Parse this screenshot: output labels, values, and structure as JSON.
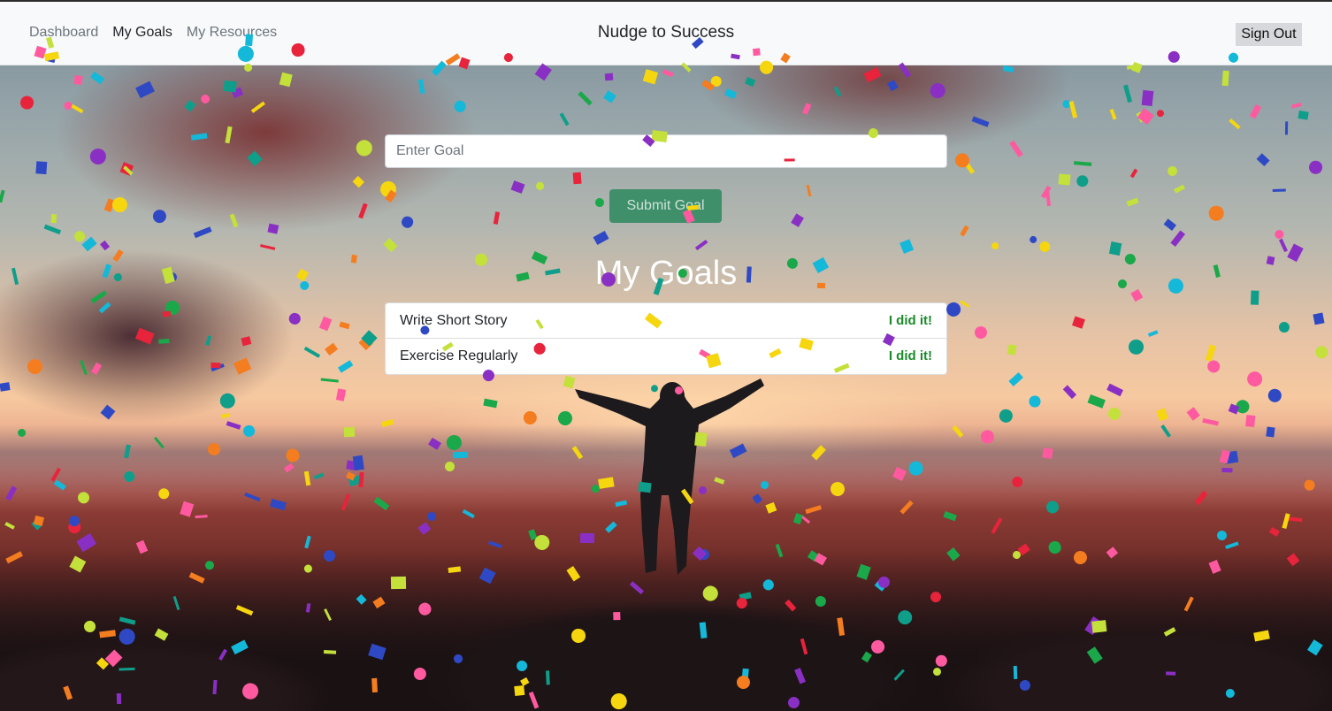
{
  "nav": {
    "links": [
      "Dashboard",
      "My Goals",
      "My Resources"
    ],
    "active": "My Goals",
    "brand": "Nudge to Success",
    "sign_out_label": "Sign Out"
  },
  "goal_form": {
    "placeholder": "Enter Goal",
    "value": "",
    "submit_label": "Submit Goal"
  },
  "goals_section": {
    "heading": "My Goals",
    "items": [
      {
        "title": "Write Short Story",
        "action_label": "I did it!"
      },
      {
        "title": "Exercise Regularly",
        "action_label": "I did it!"
      }
    ]
  },
  "colors": {
    "accent_green": "#1b8a2a",
    "submit_button": "#3f8f6a",
    "navbar": "#f8f9fa",
    "confetti": [
      "#e8243c",
      "#2f49c4",
      "#f5d60f",
      "#1aa84a",
      "#f47d20",
      "#8a2fc4",
      "#14b8d8",
      "#c4e03a",
      "#ff5aa0",
      "#0e9e8a"
    ]
  }
}
